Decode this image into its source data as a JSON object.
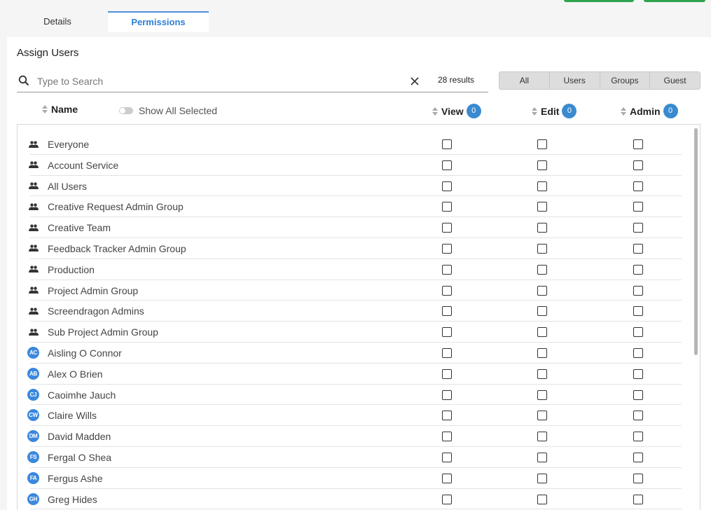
{
  "tabs": [
    {
      "label": "Details",
      "active": false
    },
    {
      "label": "Permissions",
      "active": true
    }
  ],
  "section_title": "Assign Users",
  "search": {
    "placeholder": "Type to Search",
    "value": ""
  },
  "results_text": "28 results",
  "filters": [
    "All",
    "Users",
    "Groups",
    "Guest"
  ],
  "columns": {
    "name": "Name",
    "show_all_selected": "Show All Selected",
    "view": {
      "label": "View",
      "count": "0"
    },
    "edit": {
      "label": "Edit",
      "count": "0"
    },
    "admin": {
      "label": "Admin",
      "count": "0"
    }
  },
  "colors": {
    "accent": "#3a8ad0",
    "avatar": "#3b88de",
    "top_buttons": "#2ea44f"
  },
  "rows": [
    {
      "type": "group",
      "icon": "group-icon",
      "name": "Everyone"
    },
    {
      "type": "group",
      "icon": "group-icon",
      "name": "Account Service"
    },
    {
      "type": "group",
      "icon": "group-icon",
      "name": "All Users"
    },
    {
      "type": "group",
      "icon": "group-icon",
      "name": "Creative Request Admin Group"
    },
    {
      "type": "group",
      "icon": "group-icon",
      "name": "Creative Team"
    },
    {
      "type": "group",
      "icon": "group-icon",
      "name": "Feedback Tracker Admin Group"
    },
    {
      "type": "group",
      "icon": "group-icon",
      "name": "Production"
    },
    {
      "type": "group",
      "icon": "group-icon",
      "name": "Project Admin Group"
    },
    {
      "type": "group",
      "icon": "group-icon",
      "name": "Screendragon Admins"
    },
    {
      "type": "group",
      "icon": "group-icon",
      "name": "Sub Project Admin Group"
    },
    {
      "type": "user",
      "initials": "AC",
      "name": "Aisling O Connor"
    },
    {
      "type": "user",
      "initials": "AB",
      "name": "Alex O Brien"
    },
    {
      "type": "user",
      "initials": "CJ",
      "name": "Caoimhe Jauch"
    },
    {
      "type": "user",
      "initials": "CW",
      "name": "Claire Wills"
    },
    {
      "type": "user",
      "initials": "DM",
      "name": "David Madden"
    },
    {
      "type": "user",
      "initials": "FS",
      "name": "Fergal O Shea"
    },
    {
      "type": "user",
      "initials": "FA",
      "name": "Fergus Ashe"
    },
    {
      "type": "user",
      "initials": "GH",
      "name": "Greg Hides"
    }
  ]
}
